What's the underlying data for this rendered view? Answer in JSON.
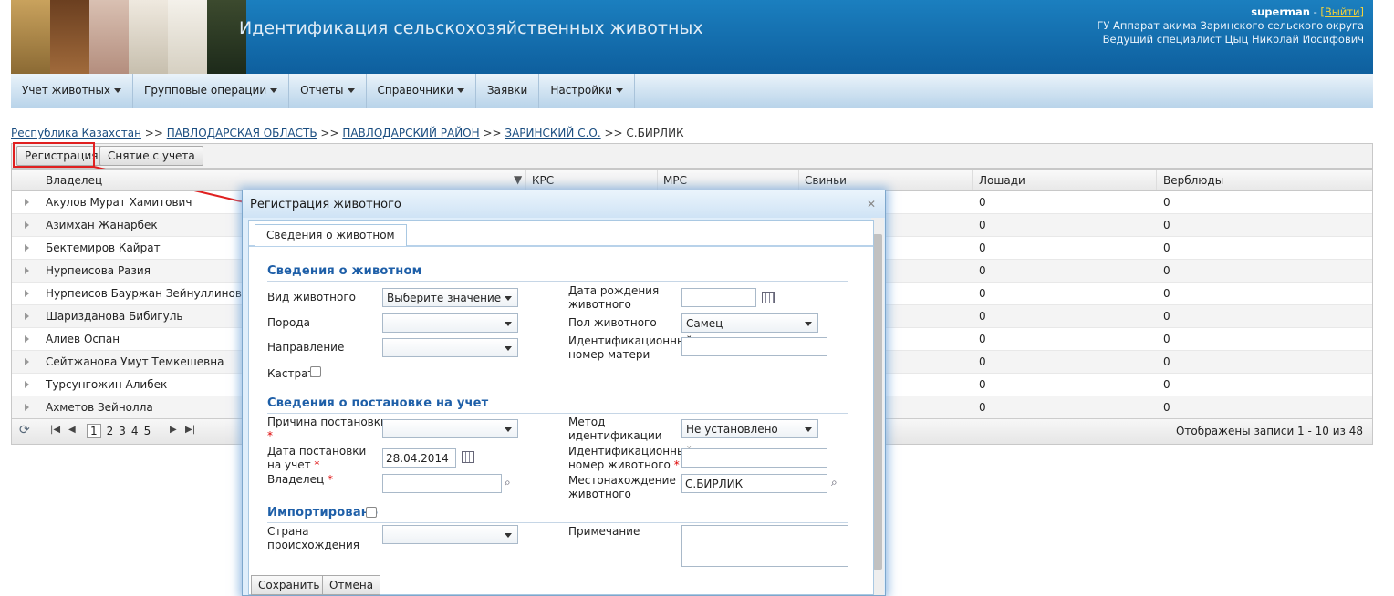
{
  "app": {
    "title": "Идентификация сельскохозяйственных животных"
  },
  "user": {
    "name": "superman",
    "sep": " - ",
    "logout": "[Выйти]",
    "org": "ГУ Аппарат акима Заринского сельского округа",
    "position": "Ведущий специалист Цыц Николай Иосифович"
  },
  "menu": [
    {
      "label": "Учет животных",
      "caret": true
    },
    {
      "label": "Групповые операции",
      "caret": true
    },
    {
      "label": "Отчеты",
      "caret": true
    },
    {
      "label": "Справочники",
      "caret": true
    },
    {
      "label": "Заявки",
      "caret": false
    },
    {
      "label": "Настройки",
      "caret": true
    }
  ],
  "breadcrumb": {
    "root": "Республика Казахстан",
    "l1": "ПАВЛОДАРСКАЯ ОБЛАСТЬ",
    "l2": "ПАВЛОДАРСКИЙ РАЙОН",
    "l3": "ЗАРИНСКИЙ С.О.",
    "current": "С.БИРЛИК",
    "sep": " >> "
  },
  "toolbar": {
    "register": "Регистрация",
    "deregister": "Снятие с учета"
  },
  "grid": {
    "columns": [
      "Владелец",
      "КРС",
      "МРС",
      "Свиньи",
      "Лошади",
      "Верблюды"
    ],
    "rows": [
      {
        "owner": "Акулов Мурат Хамитович",
        "horses": "0",
        "camels": "0"
      },
      {
        "owner": "Азимхан Жанарбек",
        "horses": "0",
        "camels": "0"
      },
      {
        "owner": "Бектемиров Кайрат",
        "horses": "0",
        "camels": "0"
      },
      {
        "owner": "Нурпеисова Разия",
        "horses": "0",
        "camels": "0"
      },
      {
        "owner": "Нурпеисов Бауржан Зейнуллинович",
        "horses": "0",
        "camels": "0"
      },
      {
        "owner": "Шаризданова Бибигуль",
        "horses": "0",
        "camels": "0"
      },
      {
        "owner": "Алиев Оспан",
        "horses": "0",
        "camels": "0"
      },
      {
        "owner": "Сейтжанова Умут Темкешевна",
        "horses": "0",
        "camels": "0"
      },
      {
        "owner": "Турсунгожин Алибек",
        "horses": "0",
        "camels": "0"
      },
      {
        "owner": "Ахметов Зейнолла",
        "horses": "0",
        "camels": "0"
      }
    ],
    "pager": {
      "pages": [
        "1",
        "2",
        "3",
        "4",
        "5"
      ],
      "current": "1",
      "status": "Отображены записи 1 - 10 из 48"
    }
  },
  "dialog": {
    "title": "Регистрация животного",
    "tab": "Сведения о животном",
    "sec1": "Сведения о животном",
    "sec2": "Сведения о постановке на учет",
    "sec3": "Импортировано",
    "animal_type_label": "Вид животного",
    "animal_type_value": "Выберите значение",
    "breed_label": "Порода",
    "direction_label": "Направление",
    "castrated_label": "Кастрат",
    "birth_date_label_1": "Дата рождения",
    "birth_date_label_2": "животного",
    "sex_label": "Пол животного",
    "sex_value": "Самец",
    "mother_id_label_1": "Идентификационный",
    "mother_id_label_2": "номер матери",
    "reason_label": "Причина постановки",
    "reg_date_label_1": "Дата постановки",
    "reg_date_label_2": "на учет",
    "reg_date_value": "28.04.2014",
    "owner_label": "Владелец",
    "method_label_1": "Метод",
    "method_label_2": "идентификации",
    "method_value": "Не установлено",
    "animal_id_label_1": "Идентификационный",
    "animal_id_label_2": "номер животного",
    "location_label_1": "Местонахождение",
    "location_label_2": "животного",
    "location_value": "С.БИРЛИК",
    "country_label_1": "Страна",
    "country_label_2": "происхождения",
    "note_label": "Примечание",
    "save": "Сохранить",
    "cancel": "Отмена",
    "required": "*"
  },
  "colors": {
    "header": "#1b7fbf",
    "section": "#1e5fa8",
    "highlight": "#e02020"
  }
}
